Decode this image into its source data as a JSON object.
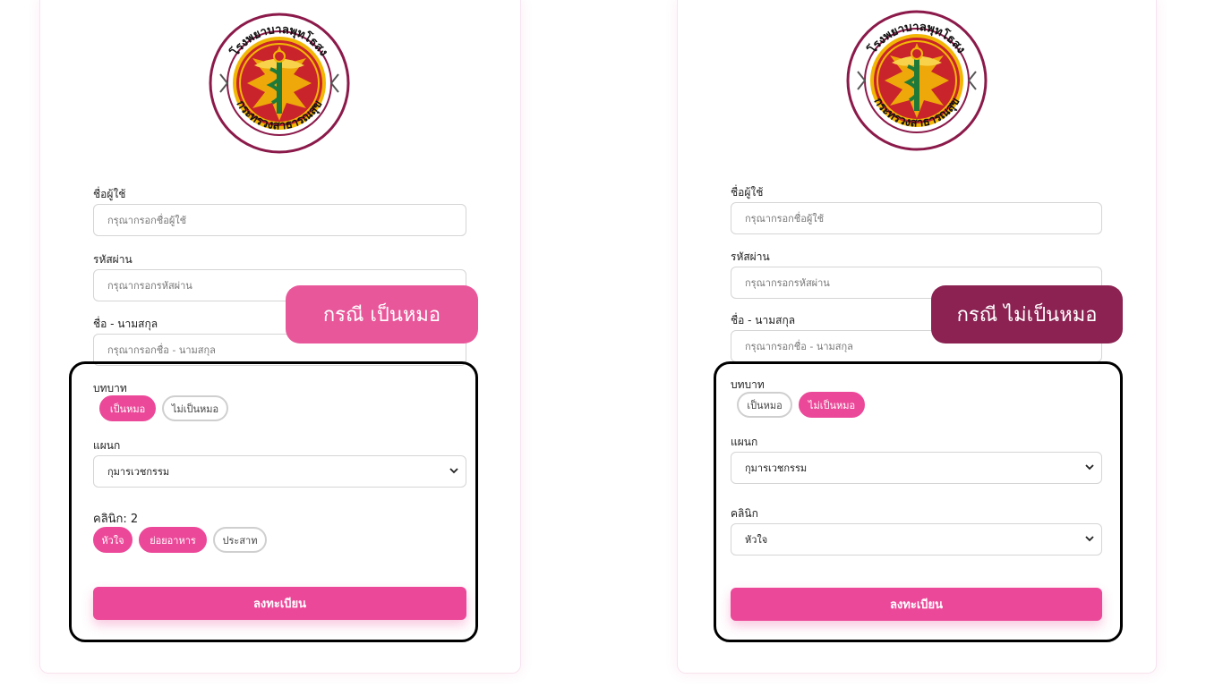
{
  "left": {
    "callout": "กรณี เป็นหมอ",
    "username": {
      "label": "ชื่อผู้ใช้",
      "placeholder": "กรุณากรอกชื่อผู้ใช้"
    },
    "password": {
      "label": "รหัสผ่าน",
      "placeholder": "กรุณากรอกรหัสผ่าน"
    },
    "fullname": {
      "label": "ชื่อ - นามสกุล",
      "placeholder": "กรุณากรอกชื่อ - นามสกุล"
    },
    "role": {
      "label": "บทบาท",
      "options": [
        {
          "label": "เป็นหมอ",
          "selected": true
        },
        {
          "label": "ไม่เป็นหมอ",
          "selected": false
        }
      ]
    },
    "department": {
      "label": "แผนก",
      "value": "กุมารเวชกรรม"
    },
    "clinic": {
      "label": "คลินิก: 2",
      "options": [
        {
          "label": "หัวใจ",
          "selected": true
        },
        {
          "label": "ย่อยอาหาร",
          "selected": true
        },
        {
          "label": "ประสาท",
          "selected": false
        }
      ]
    },
    "submit": "ลงทะเบียน"
  },
  "right": {
    "callout": "กรณี ไม่เป็นหมอ",
    "username": {
      "label": "ชื่อผู้ใช้",
      "placeholder": "กรุณากรอกชื่อผู้ใช้"
    },
    "password": {
      "label": "รหัสผ่าน",
      "placeholder": "กรุณากรอกรหัสผ่าน"
    },
    "fullname": {
      "label": "ชื่อ - นามสกุล",
      "placeholder": "กรุณากรอกชื่อ - นามสกุล"
    },
    "role": {
      "label": "บทบาท",
      "options": [
        {
          "label": "เป็นหมอ",
          "selected": false
        },
        {
          "label": "ไม่เป็นหมอ",
          "selected": true
        }
      ]
    },
    "department": {
      "label": "แผนก",
      "value": "กุมารเวชกรรม"
    },
    "clinic": {
      "label": "คลินิก",
      "value": "หัวใจ"
    },
    "submit": "ลงทะเบียน"
  },
  "logo": {
    "top_text": "โรงพยาบาลพุทโธสง",
    "bottom_text": "กระทรวงสาธารณสุข",
    "icon": "ministry-of-public-health-seal"
  },
  "colors": {
    "accent": "#ec4899",
    "callout_left": "#e8579a",
    "callout_right": "#8b2252",
    "seal_ring": "#8b1a4a",
    "seal_gold": "#f2b705",
    "seal_red": "#c9242b",
    "seal_green": "#1f7a3a"
  }
}
